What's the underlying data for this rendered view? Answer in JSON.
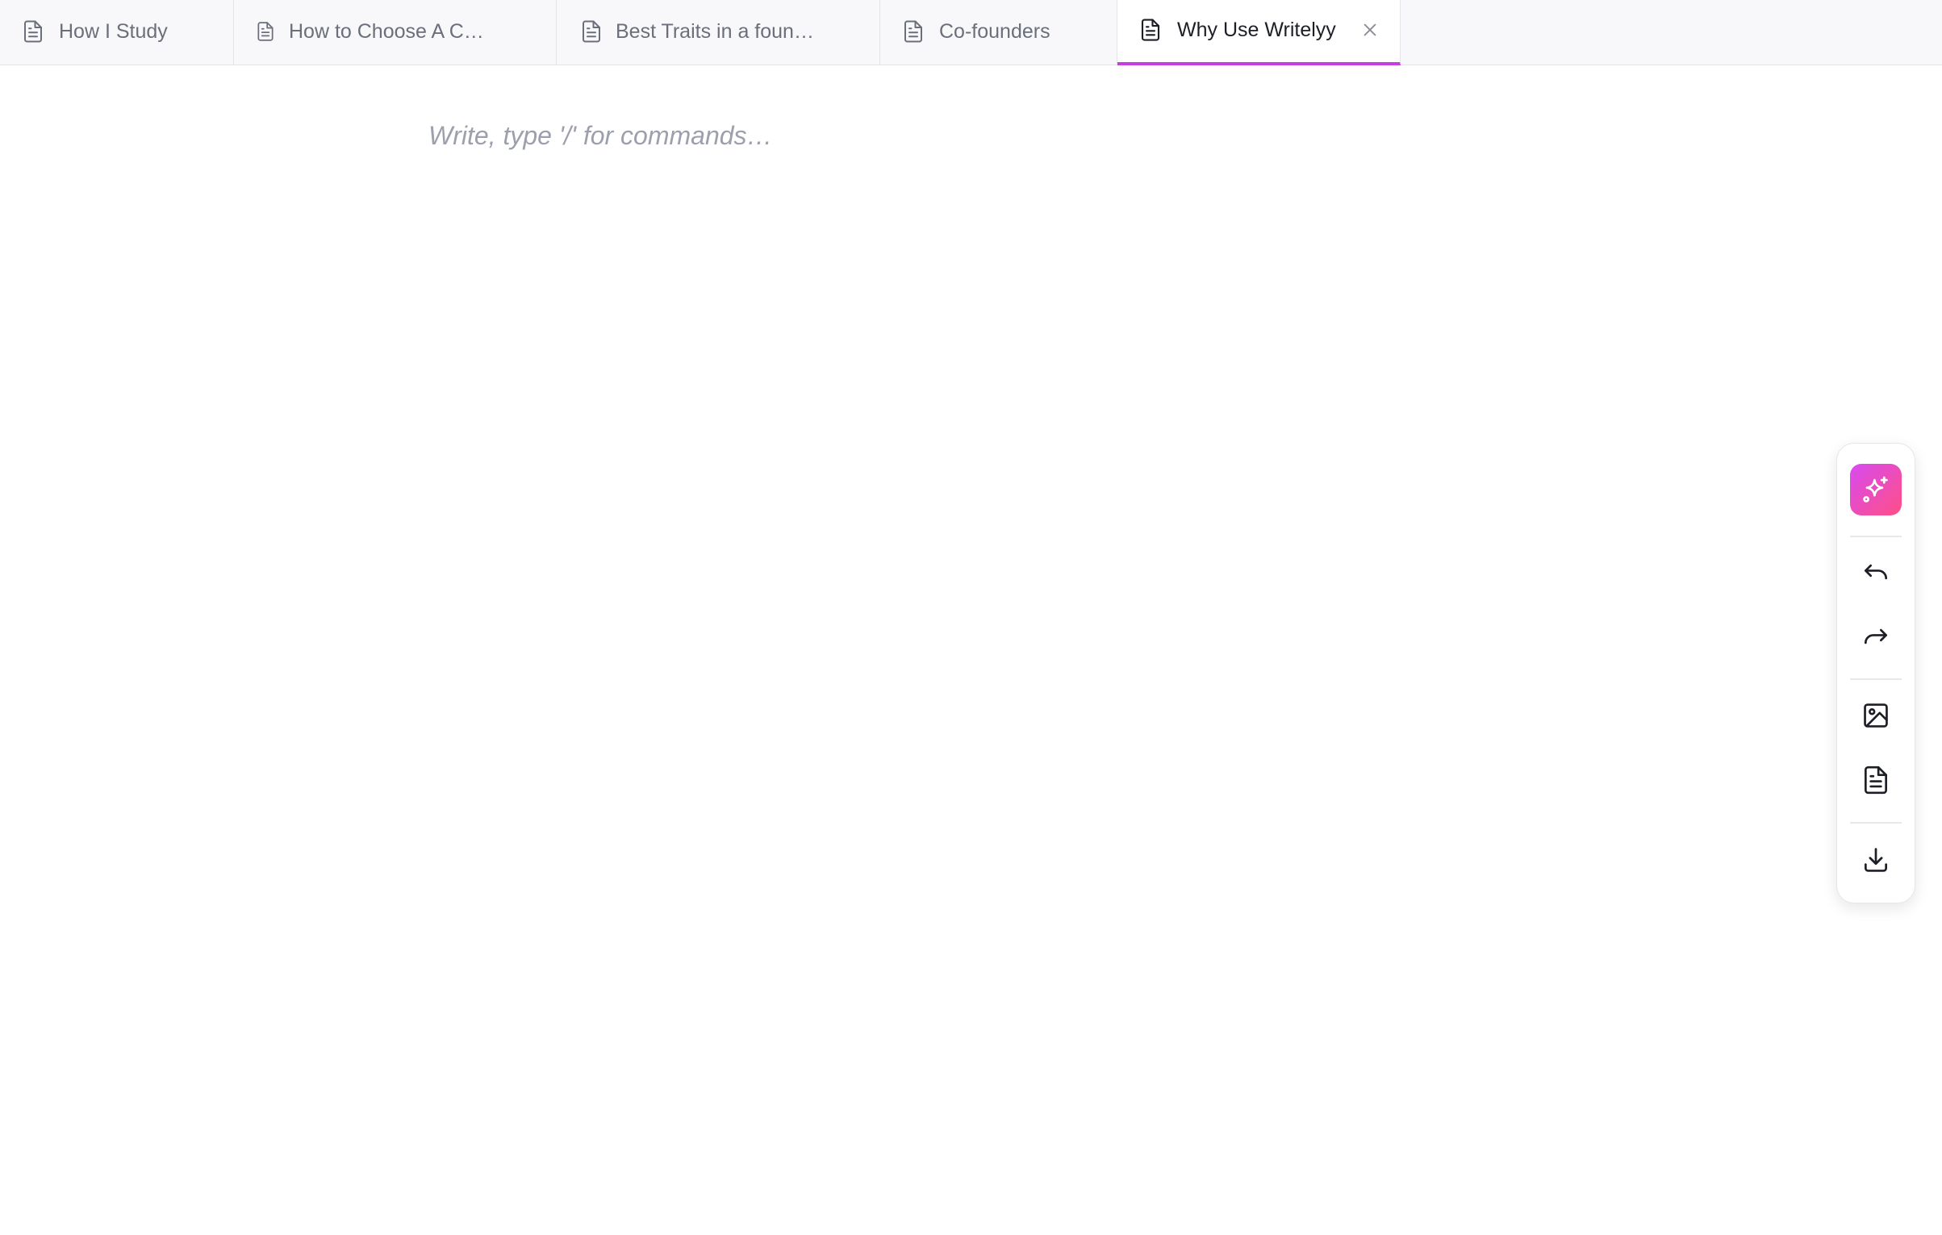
{
  "tabs": [
    {
      "label": "How I Study",
      "icon": "document-icon",
      "active": false
    },
    {
      "label": "How to Choose A C…",
      "icon": "document-icon",
      "active": false
    },
    {
      "label": "Best Traits in a foun…",
      "icon": "document-icon",
      "active": false
    },
    {
      "label": "Co-founders",
      "icon": "document-icon",
      "active": false
    },
    {
      "label": "Why Use Writelyy",
      "icon": "document-icon",
      "active": true
    }
  ],
  "editor": {
    "placeholder": "Write, type '/' for commands…"
  },
  "toolbar": {
    "items": [
      "sparkles-icon",
      "undo-icon",
      "redo-icon",
      "image-icon",
      "document-icon",
      "download-icon"
    ]
  },
  "colors": {
    "accent": "#c63ee0",
    "ai_gradient_start": "#d84bf0",
    "ai_gradient_end": "#ff4f86",
    "tabbar_bg": "#f8f8fa",
    "placeholder": "#9c9fac"
  }
}
